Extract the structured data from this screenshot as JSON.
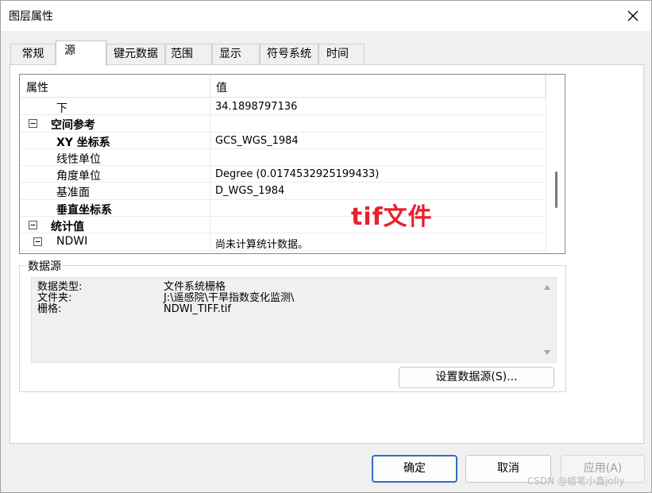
{
  "window": {
    "title": "图层属性"
  },
  "tabs": [
    {
      "label": "常规"
    },
    {
      "label": "源"
    },
    {
      "label": "键元数据"
    },
    {
      "label": "范围"
    },
    {
      "label": "显示"
    },
    {
      "label": "符号系统"
    },
    {
      "label": "时间"
    }
  ],
  "active_tab": "源",
  "property_grid": {
    "header_name": "属性",
    "header_value": "值",
    "rows": [
      {
        "name": "下",
        "value": "34.1898797136",
        "bold": false,
        "indent": 1,
        "expander": ""
      },
      {
        "name": "空间参考",
        "value": "",
        "bold": true,
        "indent": 0,
        "expander": "⊟"
      },
      {
        "name": "XY 坐标系",
        "value": "GCS_WGS_1984",
        "bold": true,
        "indent": 1,
        "expander": ""
      },
      {
        "name": "线性单位",
        "value": "",
        "bold": false,
        "indent": 1,
        "expander": ""
      },
      {
        "name": "角度单位",
        "value": "Degree (0.0174532925199433)",
        "bold": false,
        "indent": 1,
        "expander": ""
      },
      {
        "name": "基准面",
        "value": "D_WGS_1984",
        "bold": false,
        "indent": 1,
        "expander": ""
      },
      {
        "name": "垂直坐标系",
        "value": "",
        "bold": true,
        "indent": 1,
        "expander": ""
      },
      {
        "name": "统计值",
        "value": "",
        "bold": true,
        "indent": 0,
        "expander": "⊟"
      },
      {
        "name": "NDWI",
        "value": "尚未计算统计数据。",
        "bold": false,
        "indent": 1,
        "expander": "⊟"
      }
    ]
  },
  "annotation": {
    "text": "tif文件",
    "color": "#e8212e"
  },
  "datasource": {
    "group_label": "数据源",
    "lines": [
      {
        "label": "数据类型:",
        "value": "文件系统栅格"
      },
      {
        "label": "文件夹:",
        "value": "J:\\遥感院\\干旱指数变化监测\\"
      },
      {
        "label": "栅格:",
        "value": "NDWI_TIFF.tif"
      }
    ],
    "set_button": "设置数据源(S)..."
  },
  "buttons": {
    "ok": "确定",
    "cancel": "取消",
    "apply": "应用(A)"
  },
  "watermark": "CSDN @蜡笔小鑫jolly",
  "colors": {
    "accent": "#2f6fbf",
    "annotation_red": "#e8212e"
  }
}
